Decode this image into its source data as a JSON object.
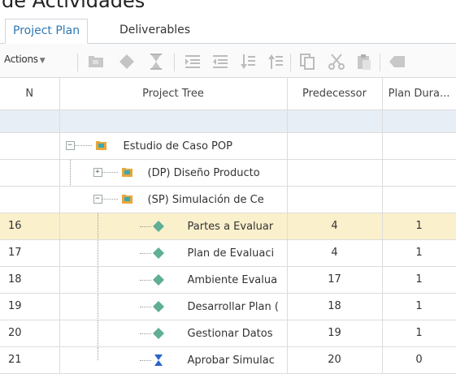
{
  "page": {
    "heading_fragment": "de Actividades"
  },
  "tabs": [
    {
      "label": "Project Plan",
      "active": true
    },
    {
      "label": "Deliverables",
      "active": false
    }
  ],
  "toolbar": {
    "actions_label": "Actions",
    "icons": [
      "folder-icon",
      "milestone-diamond-icon",
      "hourglass-icon",
      "indent-icon",
      "outdent-icon",
      "move-down-icon",
      "move-up-icon",
      "copy-icon",
      "cut-icon",
      "paste-icon",
      "delete-icon"
    ]
  },
  "columns": {
    "n": "N",
    "tree": "Project Tree",
    "pred": "Predecessor",
    "dur": "Plan Dura..."
  },
  "rows": [
    {
      "n": "",
      "name": "Estudio de Caso POP",
      "kind": "summary-open",
      "pred": "",
      "dur": ""
    },
    {
      "n": "",
      "name": "(DP) Diseño Producto",
      "kind": "summary-closed",
      "pred": "",
      "dur": ""
    },
    {
      "n": "",
      "name": "(SP) Simulación de Ce",
      "kind": "summary-open",
      "pred": "",
      "dur": ""
    },
    {
      "n": "16",
      "name": "Partes a Evaluar",
      "kind": "task",
      "pred": "4",
      "dur": "1"
    },
    {
      "n": "17",
      "name": "Plan de Evaluaci",
      "kind": "task",
      "pred": "4",
      "dur": "1"
    },
    {
      "n": "18",
      "name": "Ambiente Evalua",
      "kind": "task",
      "pred": "17",
      "dur": "1"
    },
    {
      "n": "19",
      "name": "Desarrollar Plan (",
      "kind": "task",
      "pred": "18",
      "dur": "1"
    },
    {
      "n": "20",
      "name": "Gestionar Datos",
      "kind": "task",
      "pred": "19",
      "dur": "1"
    },
    {
      "n": "21",
      "name": "Aprobar Simulac",
      "kind": "milestone",
      "pred": "20",
      "dur": "0"
    }
  ],
  "colors": {
    "accent": "#2f78b5",
    "task_diamond": "#5fae95",
    "selection": "#fbf0cc",
    "filter_row": "#e8eef6",
    "milestone": "#2a63c9"
  }
}
